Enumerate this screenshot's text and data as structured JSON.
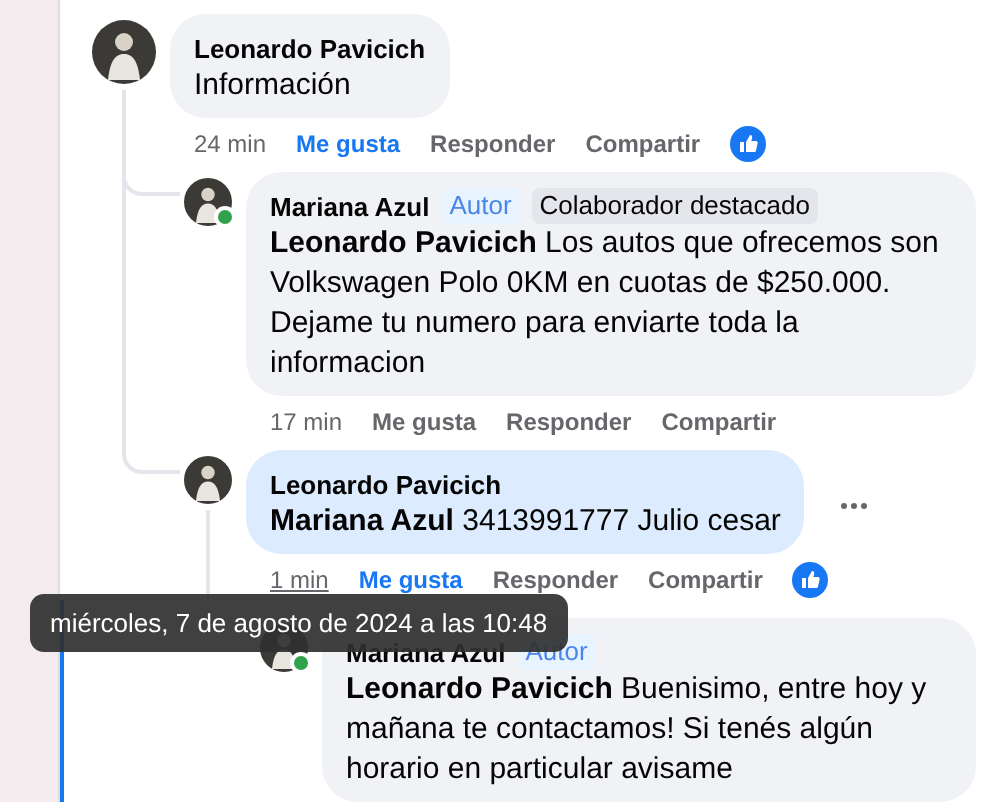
{
  "comments": [
    {
      "author": "Leonardo Pavicich",
      "text": "Información",
      "time": "24 min",
      "like_label": "Me gusta",
      "liked": true,
      "reply_label": "Responder",
      "share_label": "Compartir",
      "reacted": true,
      "replies": [
        {
          "author": "Mariana Azul",
          "online": true,
          "badges": [
            {
              "kind": "author",
              "label": "Autor"
            },
            {
              "kind": "contributor",
              "label": "Colaborador destacado"
            }
          ],
          "text": "**Leonardo Pavicich** Los autos que ofrecemos son Volkswagen Polo 0KM en cuotas de $250.000. Dejame tu numero para enviarte toda la informacion",
          "time": "17 min",
          "like_label": "Me gusta",
          "liked": false,
          "reply_label": "Responder",
          "share_label": "Compartir"
        },
        {
          "author": "Leonardo Pavicich",
          "text": "**Mariana Azul** 3413991777 Julio cesar",
          "highlighted": true,
          "menu": true,
          "time": "1 min",
          "time_hovered": true,
          "like_label": "Me gusta",
          "liked": true,
          "reply_label": "Responder",
          "share_label": "Compartir",
          "reacted": true,
          "replies": [
            {
              "author": "Mariana Azul",
              "online": true,
              "badges": [
                {
                  "kind": "author",
                  "label": "Autor"
                }
              ],
              "text": "**Leonardo Pavicich** Buenisimo, entre hoy y mañana te contactamos! Si tenés algún horario en particular avisame"
            }
          ]
        }
      ]
    }
  ],
  "tooltip": {
    "text": "miércoles, 7 de agosto de 2024 a las 10:48"
  }
}
